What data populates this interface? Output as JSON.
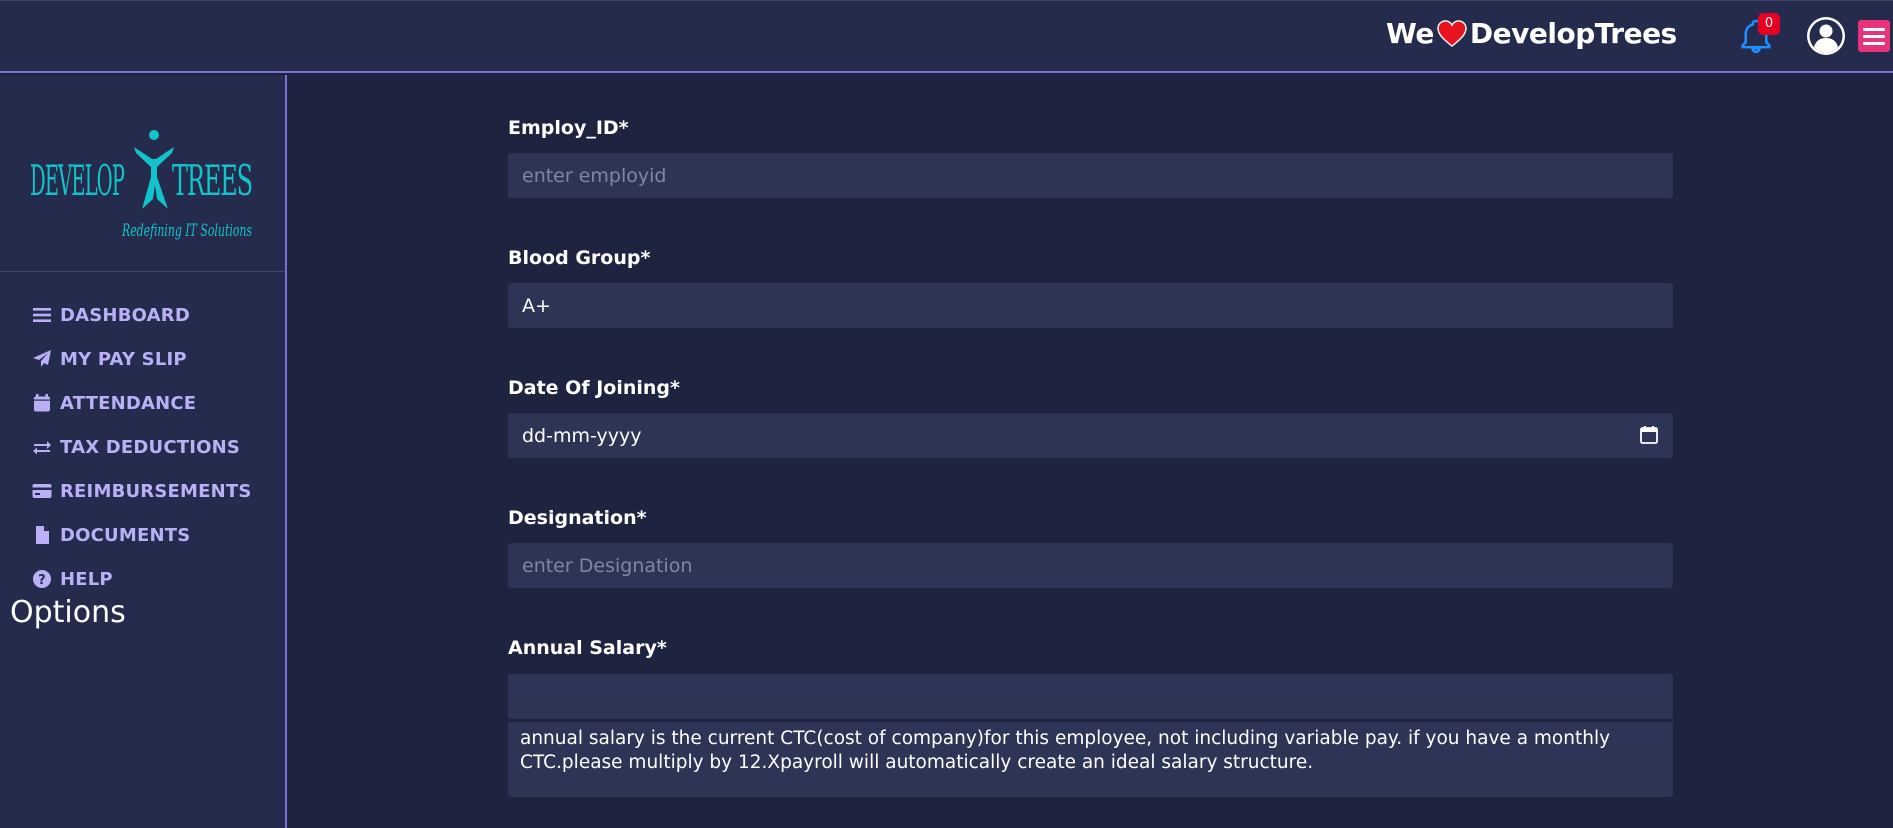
{
  "header": {
    "brand_prefix": "We",
    "brand_name": "DevelopTrees",
    "notification_count": "0"
  },
  "sidebar": {
    "logo_text": "DEVELOP TREES",
    "logo_tagline": "Redefining IT Solutions",
    "items": [
      {
        "label": "DASHBOARD",
        "icon": "bars-icon"
      },
      {
        "label": "MY PAY SLIP",
        "icon": "paper-plane-icon"
      },
      {
        "label": "ATTENDANCE",
        "icon": "calendar-icon"
      },
      {
        "label": "TAX DEDUCTIONS",
        "icon": "exchange-icon"
      },
      {
        "label": "REIMBURSEMENTS",
        "icon": "credit-card-icon"
      },
      {
        "label": "DOCUMENTS",
        "icon": "file-icon"
      },
      {
        "label": "HELP",
        "icon": "question-circle-icon"
      }
    ],
    "options_label": "Options"
  },
  "form": {
    "employ_id": {
      "label": "Employ_ID*",
      "placeholder": "enter employid",
      "value": ""
    },
    "blood_group": {
      "label": "Blood Group*",
      "value": "A+"
    },
    "date_of_joining": {
      "label": "Date Of Joining*",
      "value": "dd-mm-yyyy"
    },
    "designation": {
      "label": "Designation*",
      "placeholder": "enter Designation",
      "value": ""
    },
    "annual_salary": {
      "label": "Annual Salary*",
      "value": "",
      "note": "annual salary is the current CTC(cost of company)for this employee, not including variable pay. if you have a monthly CTC.please multiply by 12.Xpayroll will automatically create an ideal salary structure."
    }
  },
  "colors": {
    "background": "#1e2440",
    "panel": "#242b4d",
    "accent": "#7b6fd6",
    "nav_text": "#b9b0f5",
    "menu_button": "#e8337b",
    "badge": "#e60023",
    "logo": "#12c3c9"
  }
}
